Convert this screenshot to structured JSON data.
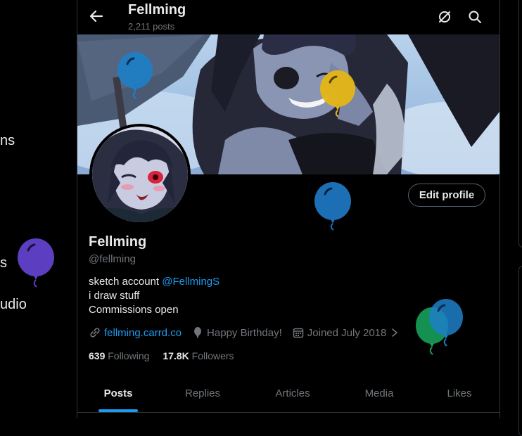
{
  "left_nav": {
    "fragments": [
      "ns",
      "s",
      "udio"
    ]
  },
  "header": {
    "title": "Fellming",
    "post_count": "2,211 posts",
    "back_icon": "arrow-left-icon",
    "icons": [
      "grok-icon",
      "search-icon"
    ]
  },
  "profile": {
    "name": "Fellming",
    "handle": "@fellming",
    "edit_button": "Edit profile",
    "bio": {
      "line1_text": "sketch account ",
      "line1_mention": "@FellmingS",
      "line2": "i draw stuff",
      "line3": "Commissions open"
    },
    "meta": {
      "website": "fellming.carrd.co",
      "birthday": "Happy Birthday!",
      "joined": "Joined July 2018"
    },
    "stats": {
      "following_count": "639",
      "following_label": "Following",
      "followers_count": "17.8K",
      "followers_label": "Followers"
    }
  },
  "tabs": [
    {
      "label": "Posts",
      "active": true
    },
    {
      "label": "Replies",
      "active": false
    },
    {
      "label": "Articles",
      "active": false
    },
    {
      "label": "Media",
      "active": false
    },
    {
      "label": "Likes",
      "active": false
    }
  ],
  "colors": {
    "accent": "#1d9bf0",
    "balloon_blue": "#1d80c8",
    "balloon_yellow": "#e5b514",
    "balloon_purple": "#5b3fc0",
    "balloon_green": "#16a05a"
  }
}
